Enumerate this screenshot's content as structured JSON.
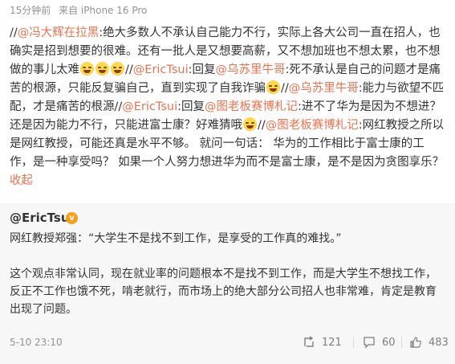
{
  "meta": {
    "time": "15分钟前",
    "source": "来自 iPhone 16 Pro"
  },
  "post": {
    "p1": "//",
    "m1": "@冯大辉在拉黑",
    "t1": ":绝大多数人不承认自己能力不行，实际上各大公司一直在招人，也确实是招到想要的很难。还有一批人是又想要高薪，又不想加班也不想太累，也不想做的事儿太难",
    "p2": "//",
    "m2": "@EricTsui",
    "t2": ":回复",
    "m3": "@乌苏里牛哥",
    "t3": ":死不承认是自己的问题才是痛苦的根源，只能反复骗自己，直到实现了自我诈骗",
    "p3": "//",
    "m4": "@乌苏里牛哥",
    "t4": ":能力与欲望不匹配，才是痛苦的根源",
    "p4": "//",
    "m5": "@EricTsui",
    "t5": ":回复",
    "m6": "@图老板赛博札记",
    "t6": ":进不了华为是因为不想进？还是因为能力不行，只能进富士康？好难猜哦",
    "p5": "//",
    "m7": "@图老板赛博札记",
    "t7": ":网红教授之所以是网红教授，可能还真是水平不够。 就问一句话： 华为的工作相比于富士康的工作，是一种享受吗？ 如果一个人努力想进华为而不是富士康，是不是因为贪图享乐？",
    "collapse": "收起"
  },
  "quote": {
    "author": "@EricTsui",
    "badge": "v",
    "line1": "网红教授郑强：“大学生不是找不到工作，是享受的工作真的难找。”",
    "line2": "这个观点非常认同，现在就业率的问题根本不是找不到工作，而是大学生不想找工作，反正不工作也饿不死，啃老就行，而市场上的绝大部分公司招人也非常难，肯定是教育出现了问题。",
    "date": "5-10 23:10",
    "reposts": "121",
    "comments": "60",
    "likes": "483"
  }
}
